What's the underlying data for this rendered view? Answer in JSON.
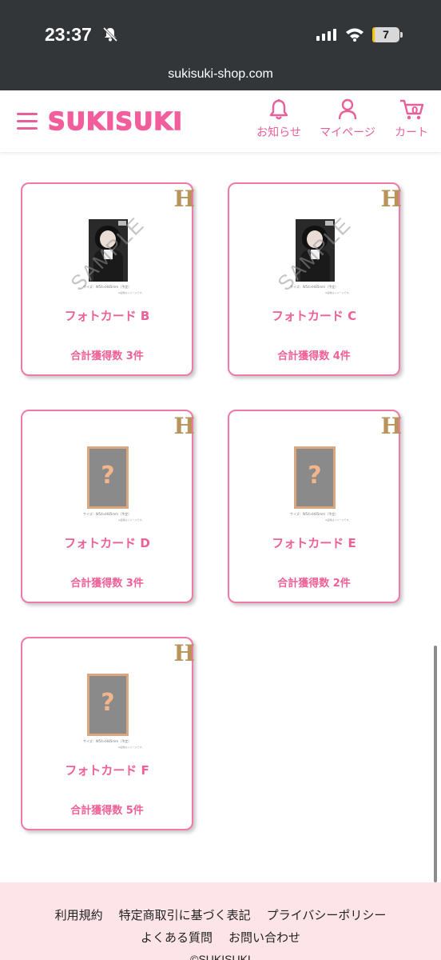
{
  "status_bar": {
    "time": "23:37",
    "battery": "7",
    "battery_level": 0.07
  },
  "browser": {
    "url": "sukisuki-shop.com"
  },
  "header": {
    "logo": "SUKISUKI",
    "notifications_label": "お知らせ",
    "mypage_label": "マイページ",
    "cart_label": "カート",
    "cart_count": "0"
  },
  "cards": [
    {
      "grade": "H",
      "title": "フォトカード B",
      "count": "合計獲得数 3件",
      "image": "photo",
      "watermark": "SAMPLE",
      "size_note": "サイズ：W54×H85mm（予定）",
      "note": "※画像はイメージです。"
    },
    {
      "grade": "H",
      "title": "フォトカード C",
      "count": "合計獲得数 4件",
      "image": "photo",
      "watermark": "SAMPLE",
      "size_note": "サイズ：W54×H85mm（予定）",
      "note": "※画像はイメージです。"
    },
    {
      "grade": "H",
      "title": "フォトカード D",
      "count": "合計獲得数 3件",
      "image": "mystery",
      "symbol": "?",
      "size_note": "サイズ：W54×H85mm（予定）",
      "note": "※画像はイメージです。"
    },
    {
      "grade": "H",
      "title": "フォトカード E",
      "count": "合計獲得数 2件",
      "image": "mystery",
      "symbol": "?",
      "size_note": "サイズ：W54×H85mm（予定）",
      "note": "※画像はイメージです。"
    },
    {
      "grade": "H",
      "title": "フォトカード F",
      "count": "合計獲得数 5件",
      "image": "mystery",
      "symbol": "?",
      "size_note": "サイズ：W54×H85mm（予定）",
      "note": "※画像はイメージです。"
    }
  ],
  "footer": {
    "links_row1": [
      "利用規約",
      "特定商取引に基づく表記",
      "プライバシーポリシー"
    ],
    "links_row2": [
      "よくある質問",
      "お問い合わせ"
    ],
    "copyright": "©SUKISUKI"
  },
  "colors": {
    "brand_pink": "#f25d9c",
    "card_border": "#ee7aa7",
    "grade_gold": "#b8935a",
    "footer_bg": "#fce4e8",
    "browser_chrome": "#323639",
    "battery_fill": "#f5c400"
  }
}
